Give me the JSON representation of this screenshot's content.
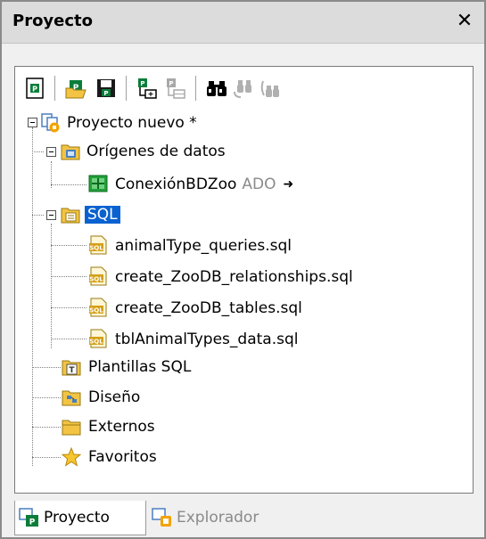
{
  "panel": {
    "title": "Proyecto",
    "close_symbol": "✕"
  },
  "toolbar": {
    "buttons": [
      {
        "icon": "new-project-icon"
      },
      {
        "icon": "open-project-icon"
      },
      {
        "icon": "save-project-icon"
      },
      {
        "icon": "add-to-project-icon"
      },
      {
        "icon": "add-folder-icon"
      },
      {
        "icon": "find-icon"
      },
      {
        "icon": "find-next-icon"
      },
      {
        "icon": "replace-icon"
      }
    ]
  },
  "tree": {
    "root": "Proyecto nuevo *",
    "datasources": "Orígenes de datos",
    "connection_name": "ConexiónBDZoo",
    "connection_type": "ADO",
    "connection_arrow": "➜",
    "sql_folder": "SQL",
    "sql_files": [
      "animalType_queries.sql",
      "create_ZooDB_relationships.sql",
      "create_ZooDB_tables.sql",
      "tblAnimalTypes_data.sql"
    ],
    "templates": "Plantillas SQL",
    "design": "Diseño",
    "external": "Externos",
    "favorites": "Favoritos"
  },
  "tabs": {
    "project": "Proyecto",
    "explorer": "Explorador"
  },
  "colors": {
    "selection": "#0a62d0",
    "folder": "#f3c443",
    "green": "#21a038"
  }
}
